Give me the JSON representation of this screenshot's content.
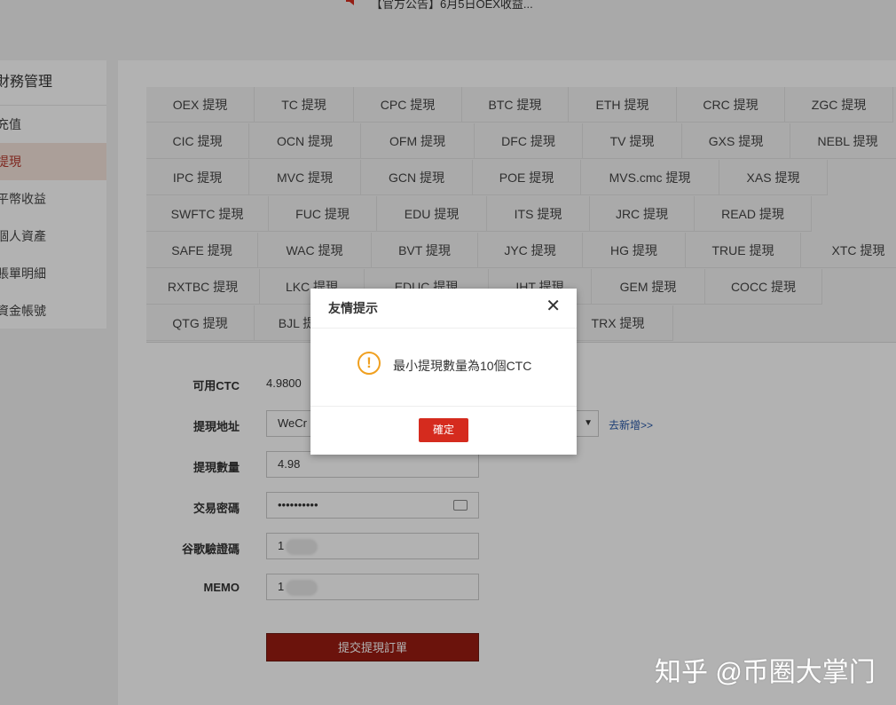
{
  "announcement": {
    "text": "【官方公告】6月5日OEX收益...",
    "icon": "speaker-icon"
  },
  "sidebar": {
    "heading": "財務管理",
    "items": [
      {
        "label": "充值",
        "active": false
      },
      {
        "label": "提現",
        "active": true
      },
      {
        "label": "平幣收益",
        "active": false
      },
      {
        "label": "個人資產",
        "active": false
      },
      {
        "label": "賬單明細",
        "active": false
      },
      {
        "label": "資金帳號",
        "active": false
      }
    ]
  },
  "tabs": [
    [
      "OEX 提現",
      "TC 提現",
      "CPC 提現",
      "BTC 提現",
      "ETH 提現",
      "CRC 提現",
      "ZGC 提現"
    ],
    [
      "CIC 提現",
      "OCN 提現",
      "OFM 提現",
      "DFC 提現",
      "TV 提現",
      "GXS 提現",
      "NEBL 提現"
    ],
    [
      "IPC 提現",
      "MVC 提現",
      "GCN 提現",
      "POE 提現",
      "MVS.cmc 提現",
      "XAS 提現"
    ],
    [
      "SWFTC 提現",
      "FUC 提現",
      "EDU 提現",
      "ITS 提現",
      "JRC 提現",
      "READ 提現"
    ],
    [
      "SAFE 提現",
      "WAC 提現",
      "BVT 提現",
      "JYC 提現",
      "HG 提現",
      "TRUE 提現",
      "XTC 提現"
    ],
    [
      "RXTBC 提現",
      "LKC 提現",
      "EDUC 提現",
      "IHT 提現",
      "GEM 提現",
      "COCC 提現"
    ],
    [
      "QTG 提現",
      "BJL 提現",
      "",
      "",
      "TRX 提現"
    ]
  ],
  "form": {
    "available_label": "可用CTC",
    "available_value": "4.9800",
    "address_label": "提現地址",
    "address_value": "WeCr",
    "add_link": "去新增>>",
    "amount_label": "提現數量",
    "amount_value": "4.98",
    "password_label": "交易密碼",
    "password_value": "••••••••••",
    "google_label": "谷歌驗證碼",
    "google_value": "1",
    "memo_label": "MEMO",
    "memo_value": "1",
    "submit_label": "提交提現訂單"
  },
  "dialog": {
    "title": "友情提示",
    "message": "最小提現數量為10個CTC",
    "confirm_label": "確定"
  },
  "watermark": "知乎 @币圈大掌门",
  "colors": {
    "active_red": "#b5372b",
    "submit_bg": "#9a1c12",
    "ok_button": "#d52b1e",
    "warning": "#f0a020"
  }
}
